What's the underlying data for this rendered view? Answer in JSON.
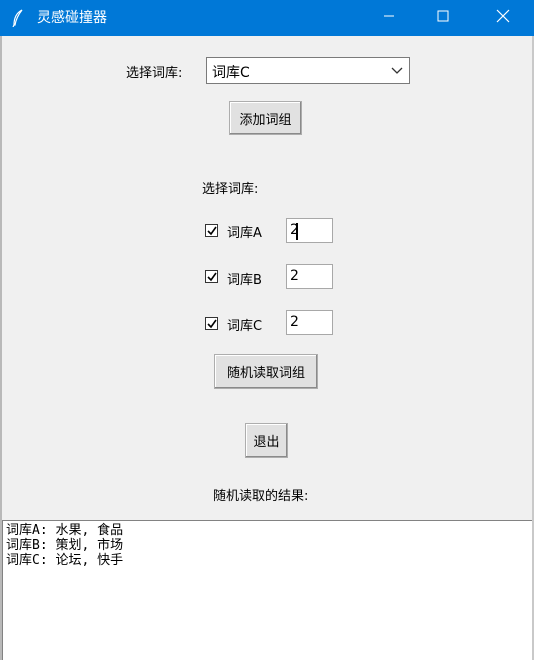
{
  "window": {
    "title": "灵感碰撞器",
    "icons": {
      "app": "feather-icon",
      "minimize": "minimize-icon",
      "maximize": "maximize-icon",
      "close": "close-icon"
    }
  },
  "library_select": {
    "label": "选择词库:",
    "selected": "词库C"
  },
  "add_button": "添加词组",
  "choose_label": "选择词库:",
  "libraries": [
    {
      "label": "词库A",
      "checked": true,
      "count": "2"
    },
    {
      "label": "词库B",
      "checked": true,
      "count": "2"
    },
    {
      "label": "词库C",
      "checked": true,
      "count": "2"
    }
  ],
  "random_button": "随机读取词组",
  "exit_button": "退出",
  "result_label": "随机读取的结果:",
  "results": [
    "词库A: 水果, 食品",
    "词库B: 策划, 市场",
    "词库C: 论坛, 快手"
  ]
}
